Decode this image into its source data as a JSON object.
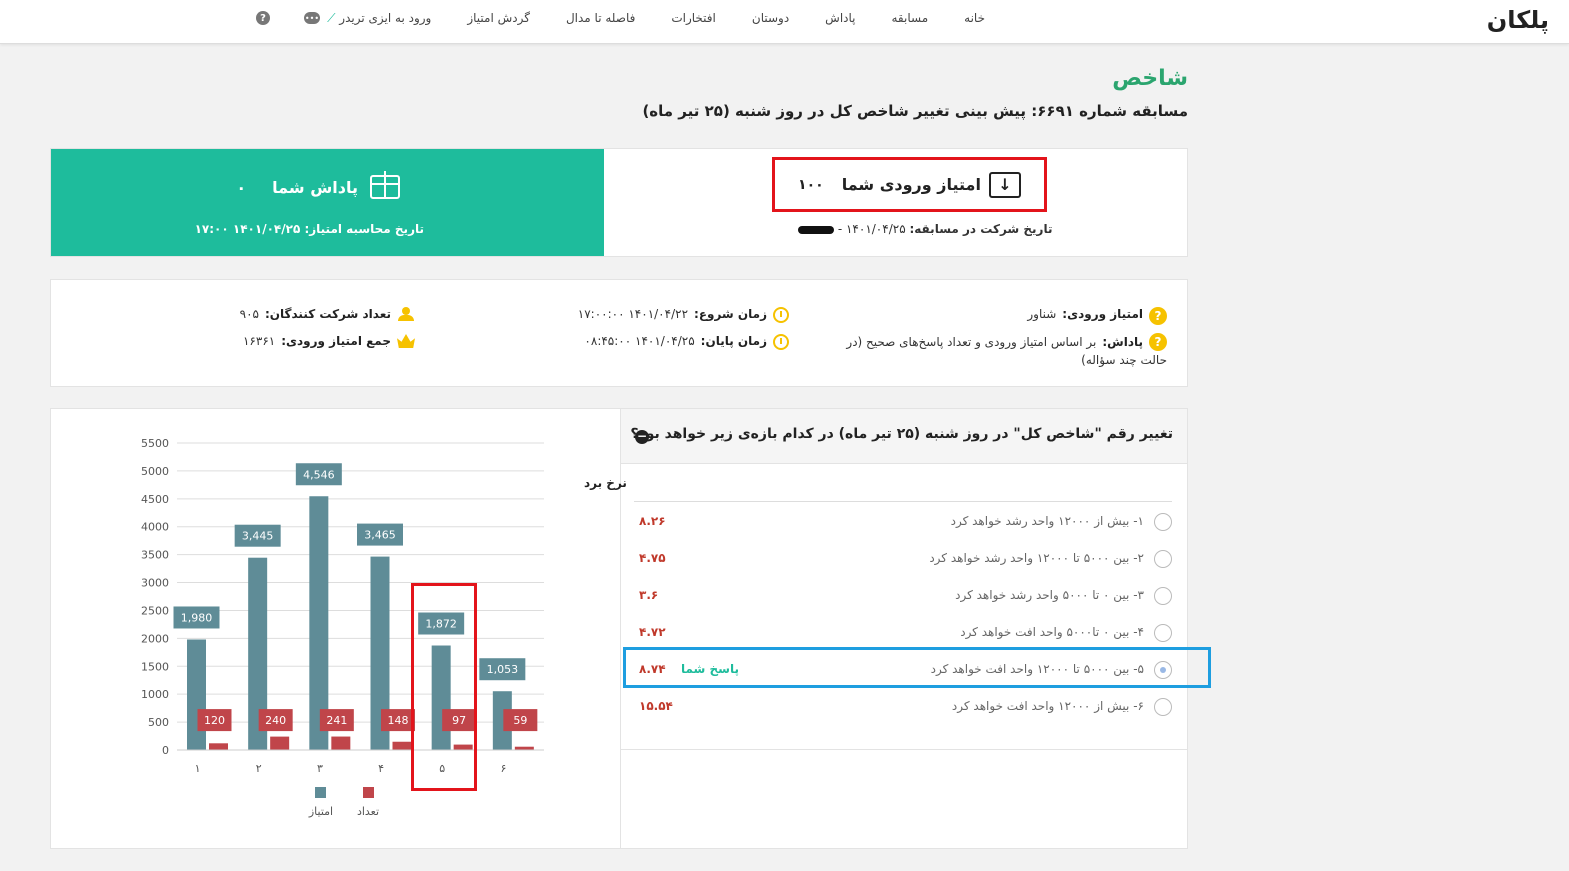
{
  "nav": {
    "logo": "پلکان",
    "links": [
      "خانه",
      "مسابقه",
      "پاداش",
      "دوستان",
      "افتخارات",
      "فاصله تا مدال",
      "گردش امتیاز",
      "ورود به ایزی تریدر"
    ],
    "help_icon": "question-icon",
    "chat_icon": "chat-icon"
  },
  "page": {
    "title": "شاخص",
    "subtitle": "مسابقه شماره ۶۶۹۱: پیش بینی تغییر شاخص کل در روز شنبه (۲۵ تیر ماه)"
  },
  "reward": {
    "title": "پاداش شما",
    "value": "۰",
    "date_label": "تاریخ محاسبه امتیاز: ۱۴۰۱/۰۴/۲۵ ۱۷:۰۰",
    "bg_color": "#1ebc9c"
  },
  "entry": {
    "label": "امتیاز ورودی شما",
    "value": "۱۰۰",
    "date_label": "تاریخ شرکت در مسابقه:",
    "date_value": "۱۴۰۱/۰۴/۲۵ -"
  },
  "info": {
    "entry_score_label": "امتیاز ورودی:",
    "entry_score_value": "شناور",
    "reward_label": "پاداش:",
    "reward_value_1": "بر اساس امتیاز ورودی و تعداد پاسخ‌های صحیح (در",
    "reward_value_2": "حالت چند سؤاله)",
    "start_label": "زمان شروع:",
    "start_value": "۱۴۰۱/۰۴/۲۲ ۱۷:۰۰:۰۰",
    "end_label": "زمان پایان:",
    "end_value": "۱۴۰۱/۰۴/۲۵ ۰۸:۴۵:۰۰",
    "participants_label": "تعداد شرکت کنندگان:",
    "participants_value": "۹۰۵",
    "total_label": "جمع امتیاز ورودی:",
    "total_value": "۱۶۳۶۱"
  },
  "question": {
    "text": "تغییر رقم \"شاخص کل\" در روز شنبه (۲۵ تیر ماه) در کدام بازه‌ی زیر خواهد بود؟",
    "rate_header": "نرخ برد",
    "your_answer": "پاسخ شما",
    "options": [
      {
        "text": "۱-  بیش از ۱۲۰۰۰ واحد رشد خواهد کرد",
        "rate": "۸.۲۶"
      },
      {
        "text": "۲-  بین ۵۰۰۰ تا ۱۲۰۰۰ واحد رشد خواهد کرد",
        "rate": "۴.۷۵"
      },
      {
        "text": "۳-  بین ۰ تا ۵۰۰۰ واحد رشد خواهد کرد",
        "rate": "۳.۶"
      },
      {
        "text": "۴-  بین ۰ تا۵۰۰۰ واحد افت خواهد کرد",
        "rate": "۴.۷۲"
      },
      {
        "text": "۵-  بین ۵۰۰۰ تا ۱۲۰۰۰ واحد افت خواهد کرد",
        "rate": "۸.۷۴"
      },
      {
        "text": "۶-  بیش از ۱۲۰۰۰ واحد افت خواهد کرد",
        "rate": "۱۵.۵۴"
      }
    ]
  },
  "chart_data": {
    "type": "bar",
    "categories": [
      "۱",
      "۲",
      "۳",
      "۴",
      "۵",
      "۶"
    ],
    "series": [
      {
        "name": "امتیاز",
        "values": [
          1980,
          3445,
          4546,
          3465,
          1872,
          1053
        ],
        "labels": [
          "1,980",
          "3,445",
          "4,546",
          "3,465",
          "1,872",
          "1,053"
        ],
        "color": "#5f8c97"
      },
      {
        "name": "تعداد",
        "values": [
          120,
          240,
          241,
          148,
          97,
          59
        ],
        "labels": [
          "120",
          "240",
          "241",
          "148",
          "97",
          "59"
        ],
        "color": "#c0454a"
      }
    ],
    "ylim": [
      0,
      5500
    ],
    "yticks": [
      "0",
      "500",
      "1000",
      "1500",
      "2000",
      "2500",
      "3000",
      "3500",
      "4000",
      "4500",
      "5000",
      "5500"
    ],
    "grid": true,
    "legend": "bottom"
  }
}
